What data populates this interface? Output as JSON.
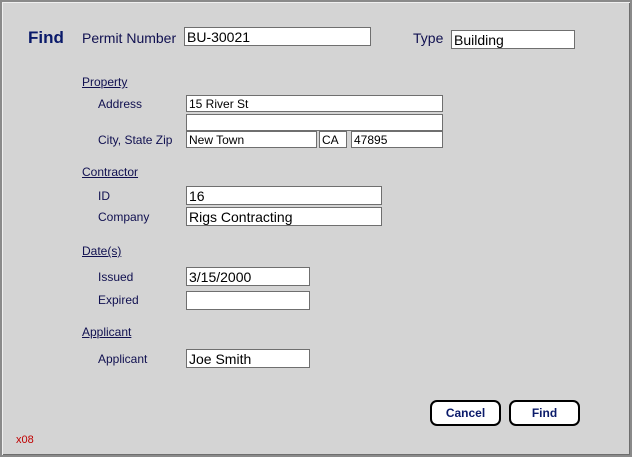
{
  "dialog": {
    "title": "Find",
    "footer_code": "x08"
  },
  "permit": {
    "label": "Permit Number",
    "value": "BU-30021"
  },
  "type": {
    "label": "Type",
    "value": "Building"
  },
  "property": {
    "section": "Property",
    "address_label": "Address",
    "address_line1": "15 River St",
    "address_line2": "",
    "city_state_zip_label": "City, State Zip",
    "city": "New Town",
    "state": "CA",
    "zip": "47895"
  },
  "contractor": {
    "section": "Contractor",
    "id_label": "ID",
    "id_value": "16",
    "company_label": "Company",
    "company_value": "Rigs Contracting"
  },
  "dates": {
    "section": "Date(s)",
    "issued_label": "Issued",
    "issued_value": "3/15/2000",
    "expired_label": "Expired",
    "expired_value": ""
  },
  "applicant": {
    "section": "Applicant",
    "label": "Applicant",
    "value": "Joe Smith"
  },
  "buttons": {
    "cancel": "Cancel",
    "find": "Find"
  }
}
